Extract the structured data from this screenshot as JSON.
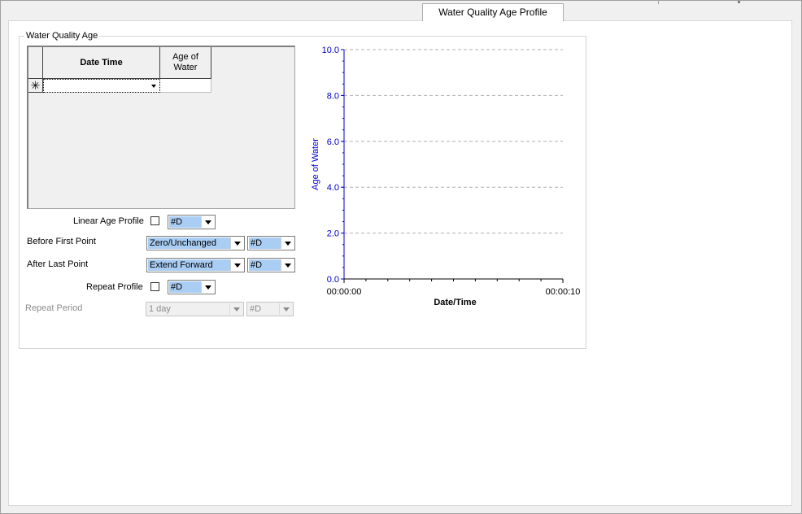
{
  "tab": {
    "label": "Water Quality Age Profile"
  },
  "group": {
    "title": "Water Quality Age"
  },
  "grid": {
    "columns": [
      "Date Time",
      "Age of\nWater"
    ],
    "col1": "Date Time",
    "col2_line1": "Age of",
    "col2_line2": "Water",
    "new_row_marker": "✳"
  },
  "form": {
    "linear_age_profile": {
      "label": "Linear Age Profile",
      "checked": false,
      "unit": "#D"
    },
    "before_first_point": {
      "label": "Before First Point",
      "value": "Zero/Unchanged",
      "unit": "#D"
    },
    "after_last_point": {
      "label": "After Last Point",
      "value": "Extend Forward",
      "unit": "#D"
    },
    "repeat_profile": {
      "label": "Repeat Profile",
      "checked": false,
      "unit": "#D"
    },
    "repeat_period": {
      "label": "Repeat Period",
      "value": "1 day",
      "unit": "#D",
      "enabled": false
    }
  },
  "chart_data": {
    "type": "line",
    "title": "",
    "xlabel": "Date/Time",
    "ylabel": "Age of Water",
    "x_tick_labels": [
      "00:00:00",
      "00:00:10"
    ],
    "y_ticks": [
      0.0,
      2.0,
      4.0,
      6.0,
      8.0,
      10.0
    ],
    "y_tick_labels": [
      "0.0",
      "2.0",
      "4.0",
      "6.0",
      "8.0",
      "10.0"
    ],
    "ylim": [
      0,
      10
    ],
    "grid": true,
    "series": [],
    "colors": {
      "axis": "#0000cc",
      "gridline": "#b0b0b0"
    }
  }
}
